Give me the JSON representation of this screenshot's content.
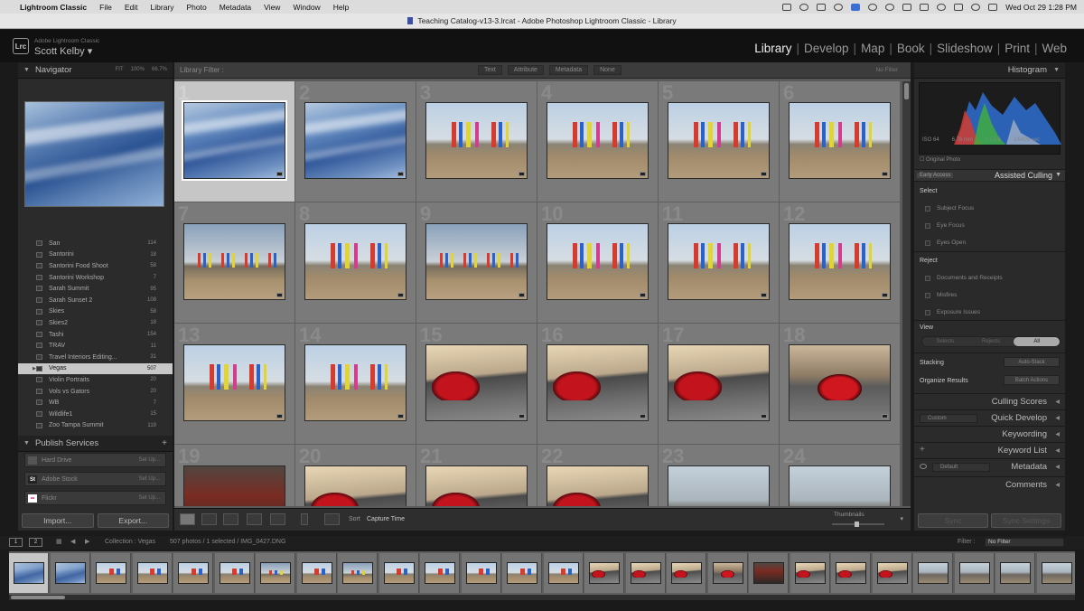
{
  "menubar": {
    "app": "Lightroom Classic",
    "items": [
      "File",
      "Edit",
      "Library",
      "Photo",
      "Metadata",
      "View",
      "Window",
      "Help"
    ],
    "clock": "Wed Oct 29  1:28 PM"
  },
  "window": {
    "title": "Teaching Catalog-v13-3.lrcat - Adobe Photoshop Lightroom Classic - Library"
  },
  "identity": {
    "logo": "Lrc",
    "product": "Adobe Lightroom Classic",
    "user": "Scott Kelby"
  },
  "modules": [
    "Library",
    "Develop",
    "Map",
    "Book",
    "Slideshow",
    "Print",
    "Web"
  ],
  "navigator": {
    "title": "Navigator",
    "zoom_options": [
      "FIT",
      "100%",
      "66.7%"
    ]
  },
  "collections": [
    {
      "name": "San",
      "count": "114"
    },
    {
      "name": "Santorini",
      "count": "18"
    },
    {
      "name": "Santorini Food Shoot",
      "count": "58"
    },
    {
      "name": "Santorini Workshop",
      "count": "7"
    },
    {
      "name": "Sarah Summit",
      "count": "95"
    },
    {
      "name": "Sarah Sunset 2",
      "count": "108"
    },
    {
      "name": "Skies",
      "count": "58"
    },
    {
      "name": "Skies2",
      "count": "18"
    },
    {
      "name": "Tashi",
      "count": "154"
    },
    {
      "name": "TRAV",
      "count": "11"
    },
    {
      "name": "Travel Interiors Editing...",
      "count": "31"
    },
    {
      "name": "Vegas",
      "count": "507",
      "selected": true
    },
    {
      "name": "Violin Portraits",
      "count": "20"
    },
    {
      "name": "Vols vs Gators",
      "count": "20"
    },
    {
      "name": "WB",
      "count": "7"
    },
    {
      "name": "Wildlife1",
      "count": "15"
    },
    {
      "name": "Zoo Tampa Summit",
      "count": "119"
    }
  ],
  "publish": {
    "title": "Publish Services",
    "services": [
      {
        "name": "Hard Drive",
        "icon": "HD",
        "action": "Set Up..."
      },
      {
        "name": "Adobe Stock",
        "icon": "St",
        "action": "Set Up..."
      },
      {
        "name": "Flickr",
        "icon": "••",
        "action": "Set Up..."
      }
    ]
  },
  "left_buttons": {
    "import": "Import...",
    "export": "Export..."
  },
  "library_filter": {
    "label": "Library Filter :",
    "options": [
      "Text",
      "Attribute",
      "Metadata",
      "None"
    ],
    "preset": "No Filter"
  },
  "grid": {
    "cells": [
      {
        "num": "1",
        "type": "sky",
        "selected": true
      },
      {
        "num": "2",
        "type": "sky"
      },
      {
        "num": "3",
        "type": "totem"
      },
      {
        "num": "4",
        "type": "totem"
      },
      {
        "num": "5",
        "type": "totem"
      },
      {
        "num": "6",
        "type": "totem"
      },
      {
        "num": "7",
        "type": "totem2"
      },
      {
        "num": "8",
        "type": "totem"
      },
      {
        "num": "9",
        "type": "totem2"
      },
      {
        "num": "10",
        "type": "totem"
      },
      {
        "num": "11",
        "type": "totem"
      },
      {
        "num": "12",
        "type": "totem"
      },
      {
        "num": "13",
        "type": "totem"
      },
      {
        "num": "14",
        "type": "totem"
      },
      {
        "num": "15",
        "type": "car"
      },
      {
        "num": "16",
        "type": "car"
      },
      {
        "num": "17",
        "type": "car"
      },
      {
        "num": "18",
        "type": "car2"
      },
      {
        "num": "19",
        "type": "dark"
      },
      {
        "num": "20",
        "type": "car"
      },
      {
        "num": "21",
        "type": "car"
      },
      {
        "num": "22",
        "type": "car"
      },
      {
        "num": "23",
        "type": "desert"
      },
      {
        "num": "24",
        "type": "desert"
      }
    ]
  },
  "toolbar": {
    "sort_label": "Sort",
    "sort_value": "Capture Time",
    "thumbnails_label": "Thumbnails"
  },
  "histogram": {
    "title": "Histogram",
    "iso": "ISO 64",
    "focal": "6.76 mm",
    "aperture": "ƒ / 1.8",
    "shutter": "1/6400 sec",
    "original": "Original Photo"
  },
  "assisted_culling": {
    "badge": "Early Access",
    "title": "Assisted Culling",
    "select_label": "Select",
    "select_items": [
      "Subject Focus",
      "Eye Focus",
      "Eyes Open"
    ],
    "reject_label": "Reject",
    "reject_items": [
      "Documents and Receipts",
      "Misfires",
      "Exposure Issues"
    ],
    "view_label": "View",
    "view_options": [
      "Selects",
      "Rejects",
      "All"
    ],
    "view_selected": "All",
    "stacking_label": "Stacking",
    "stacking_btn": "Auto-Stack",
    "organize_label": "Organize Results",
    "organize_btn": "Batch Actions"
  },
  "right_panels": {
    "culling_scores": "Culling Scores",
    "quick_develop": "Quick Develop",
    "quick_develop_preset": "Custom",
    "keywording": "Keywording",
    "keyword_list": "Keyword List",
    "metadata": "Metadata",
    "metadata_preset": "Default",
    "comments": "Comments"
  },
  "right_buttons": {
    "sync": "Sync",
    "sync_settings": "Sync Settings"
  },
  "filmstrip": {
    "page1": "1",
    "page2": "2",
    "collection": "Collection : Vegas",
    "count": "507 photos / 1 selected / IMG_0427.DNG",
    "filter_label": "Filter :",
    "filter_value": "No Filter",
    "thumbs": [
      "sky",
      "sky",
      "totem",
      "totem",
      "totem",
      "totem",
      "totem2",
      "totem",
      "totem2",
      "totem",
      "totem",
      "totem",
      "totem",
      "totem",
      "car",
      "car",
      "car",
      "car2",
      "dark",
      "car",
      "car",
      "car",
      "desert",
      "desert",
      "desert",
      "desert"
    ]
  },
  "colors": {
    "accent": "#3b6fd6",
    "selection": "#c6c6c6"
  }
}
